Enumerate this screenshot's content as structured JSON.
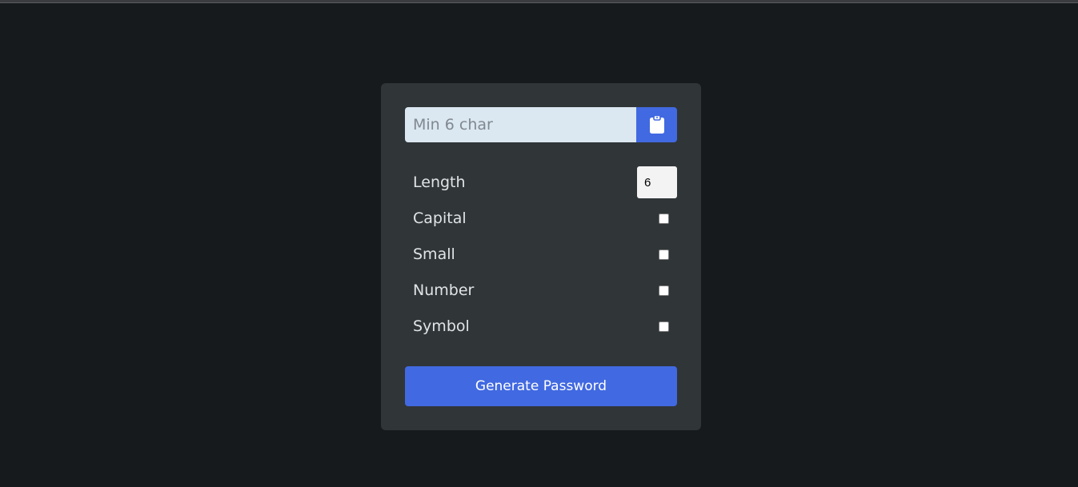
{
  "password": {
    "value": "",
    "placeholder": "Min 6 char",
    "copy_icon": "clipboard-icon"
  },
  "options": {
    "length": {
      "label": "Length",
      "value": "6"
    },
    "capital": {
      "label": "Capital",
      "checked": false
    },
    "small": {
      "label": "Small",
      "checked": false
    },
    "number": {
      "label": "Number",
      "checked": false
    },
    "symbol": {
      "label": "Symbol",
      "checked": false
    }
  },
  "generate_label": "Generate Password",
  "colors": {
    "background": "#171a1d",
    "card": "#303538",
    "accent": "#4169e1",
    "input": "#dbe7f1",
    "label": "#e1e4e6"
  }
}
